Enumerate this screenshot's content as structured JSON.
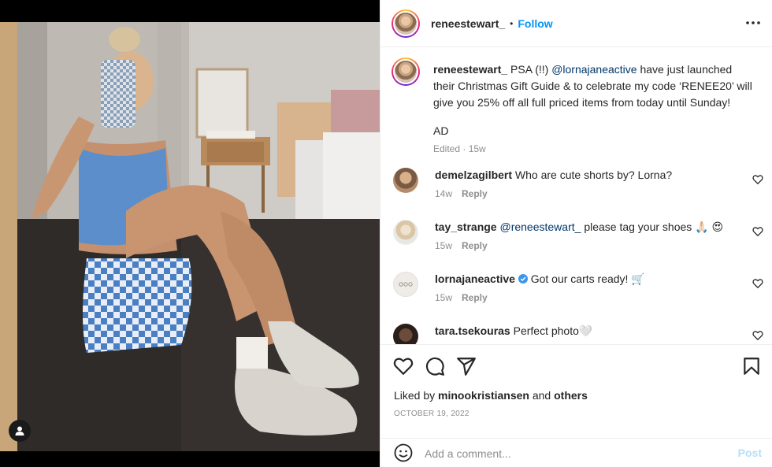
{
  "header": {
    "username": "reneestewart_",
    "separator": "•",
    "follow_label": "Follow",
    "more_icon": "more-horizontal-icon"
  },
  "caption": {
    "username": "reneestewart_",
    "text_1": " PSA (!!) ",
    "mention": "@lornajaneactive",
    "text_2": " have just launched their Christmas Gift Guide & to celebrate my code ‘RENEE20’ will give you 25% off all full priced items from today until Sunday!",
    "text_3": "AD",
    "meta": "Edited · 15w"
  },
  "comments": [
    {
      "username": "demelzagilbert",
      "text": "Who are cute shorts by? Lorna?",
      "age": "14w",
      "reply_label": "Reply"
    },
    {
      "username": "tay_strange",
      "mention": "@reneestewart_",
      "text": "please tag your shoes 🙏🏻 😍",
      "age": "15w",
      "reply_label": "Reply"
    },
    {
      "username": "lornajaneactive",
      "verified": true,
      "text": "Got our carts ready! 🛒",
      "age": "15w",
      "reply_label": "Reply"
    },
    {
      "username": "tara.tsekouras",
      "text": "Perfect photo🤍"
    }
  ],
  "actions": {
    "icons": [
      "heart-icon",
      "comment-icon",
      "share-icon",
      "bookmark-icon"
    ],
    "likes_prefix": "Liked by ",
    "likes_user": "minookristiansen",
    "likes_mid": " and ",
    "likes_others": "others",
    "date": "OCTOBER 19, 2022"
  },
  "add_comment": {
    "placeholder": "Add a comment...",
    "post_label": "Post"
  },
  "colors": {
    "accent": "#0095f6",
    "link": "#00376b",
    "muted": "#8e8e8e",
    "post_disabled": "#b2dffc"
  }
}
